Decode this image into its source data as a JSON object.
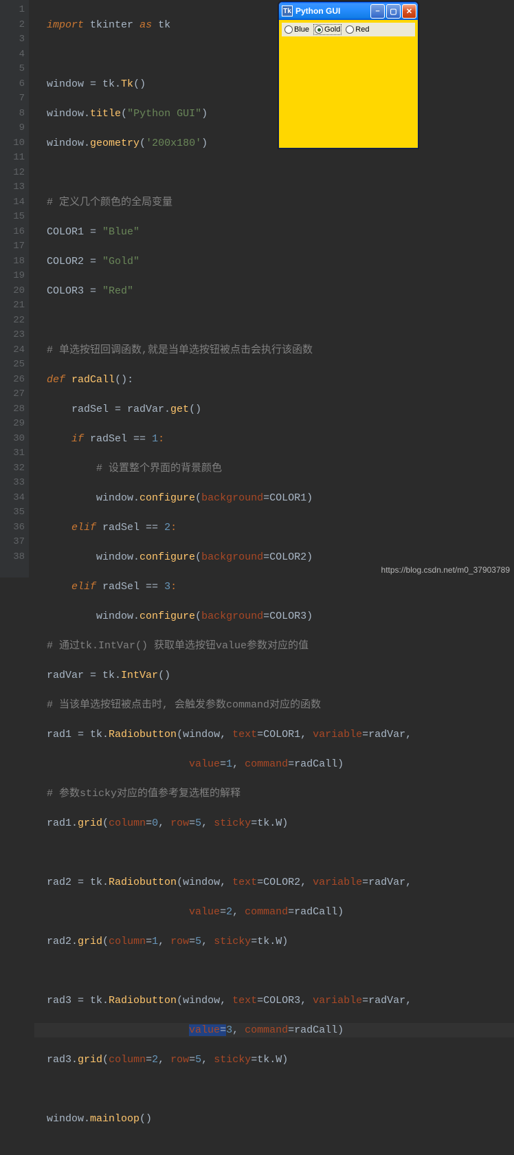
{
  "gutter": [
    "1",
    "2",
    "3",
    "4",
    "5",
    "6",
    "7",
    "8",
    "9",
    "10",
    "11",
    "12",
    "13",
    "14",
    "15",
    "16",
    "17",
    "18",
    "19",
    "20",
    "21",
    "22",
    "23",
    "24",
    "25",
    "26",
    "27",
    "28",
    "29",
    "30",
    "31",
    "32",
    "33",
    "34",
    "35",
    "36",
    "37",
    "38"
  ],
  "code": {
    "l1": {
      "a": "import",
      "b": "tkinter",
      "c": "as",
      "d": "tk"
    },
    "l3": {
      "a": "window = tk.",
      "b": "Tk",
      "c": "()"
    },
    "l4": {
      "a": "window.",
      "b": "title",
      "c": "(",
      "d": "\"Python GUI\"",
      "e": ")"
    },
    "l5": {
      "a": "window.",
      "b": "geometry",
      "c": "(",
      "d": "'200x180'",
      "e": ")"
    },
    "l7": "# 定义几个颜色的全局变量",
    "l8": {
      "a": "COLOR1 = ",
      "b": "\"Blue\""
    },
    "l9": {
      "a": "COLOR2 = ",
      "b": "\"Gold\""
    },
    "l10": {
      "a": "COLOR3 = ",
      "b": "\"Red\""
    },
    "l12": "# 单选按钮回调函数,就是当单选按钮被点击会执行该函数",
    "l13": {
      "a": "def",
      "b": "radCall",
      "c": "():"
    },
    "l14": {
      "a": "radSel = radVar.",
      "b": "get",
      "c": "()"
    },
    "l15": {
      "a": "if",
      "b": " radSel == ",
      "c": "1",
      "d": ":"
    },
    "l16": "# 设置整个界面的背景颜色",
    "l17": {
      "a": "window.",
      "b": "configure",
      "c": "(",
      "d": "background",
      "e": "=COLOR1)"
    },
    "l18": {
      "a": "elif",
      "b": " radSel == ",
      "c": "2",
      "d": ":"
    },
    "l19": {
      "a": "window.",
      "b": "configure",
      "c": "(",
      "d": "background",
      "e": "=COLOR2)"
    },
    "l20": {
      "a": "elif",
      "b": " radSel == ",
      "c": "3",
      "d": ":"
    },
    "l21": {
      "a": "window.",
      "b": "configure",
      "c": "(",
      "d": "background",
      "e": "=COLOR3)"
    },
    "l22": "# 通过tk.IntVar() 获取单选按钮value参数对应的值",
    "l23": {
      "a": "radVar = tk.",
      "b": "IntVar",
      "c": "()"
    },
    "l24": "# 当该单选按钮被点击时, 会触发参数command对应的函数",
    "l25": {
      "a": "rad1 = tk.",
      "b": "Radiobutton",
      "c": "(window, ",
      "d": "text",
      "e": "=COLOR1, ",
      "f": "variable",
      "g": "=radVar,"
    },
    "l26": {
      "a": "value",
      "b": "=",
      "c": "1",
      "d": ", ",
      "e": "command",
      "f": "=radCall)"
    },
    "l27": "# 参数sticky对应的值参考复选框的解释",
    "l28": {
      "a": "rad1.",
      "b": "grid",
      "c": "(",
      "d": "column",
      "e": "=",
      "f": "0",
      "g": ", ",
      "h": "row",
      "i": "=",
      "j": "5",
      "k": ", ",
      "l": "sticky",
      "m": "=tk.W)"
    },
    "l30": {
      "a": "rad2 = tk.",
      "b": "Radiobutton",
      "c": "(window, ",
      "d": "text",
      "e": "=COLOR2, ",
      "f": "variable",
      "g": "=radVar,"
    },
    "l31": {
      "a": "value",
      "b": "=",
      "c": "2",
      "d": ", ",
      "e": "command",
      "f": "=radCall)"
    },
    "l32": {
      "a": "rad2.",
      "b": "grid",
      "c": "(",
      "d": "column",
      "e": "=",
      "f": "1",
      "g": ", ",
      "h": "row",
      "i": "=",
      "j": "5",
      "k": ", ",
      "l": "sticky",
      "m": "=tk.W)"
    },
    "l34": {
      "a": "rad3 = tk.",
      "b": "Radiobutton",
      "c": "(window, ",
      "d": "text",
      "e": "=COLOR3, ",
      "f": "variable",
      "g": "=radVar,"
    },
    "l35": {
      "a": "value",
      "b": "=",
      "c": "3",
      "d": ", ",
      "e": "command",
      "f": "=radCall)"
    },
    "l36": {
      "a": "rad3.",
      "b": "grid",
      "c": "(",
      "d": "column",
      "e": "=",
      "f": "2",
      "g": ", ",
      "h": "row",
      "i": "=",
      "j": "5",
      "k": ", ",
      "l": "sticky",
      "m": "=tk.W)"
    },
    "l38": {
      "a": "window.",
      "b": "mainloop",
      "c": "()"
    }
  },
  "gui": {
    "title": "Python GUI",
    "icon_text": "Tk",
    "radios": [
      "Blue",
      "Gold",
      "Red"
    ],
    "selected": 1,
    "body_bg": "#ffd700"
  },
  "watermark": "https://blog.csdn.net/m0_37903789"
}
